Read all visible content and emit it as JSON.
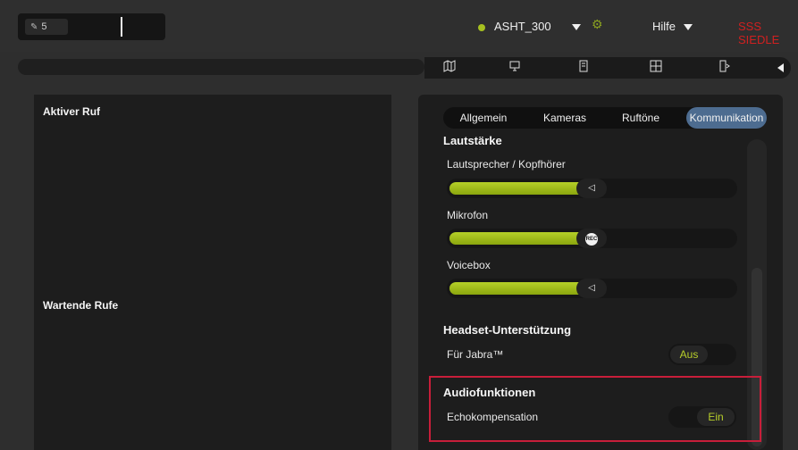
{
  "header": {
    "dialpad": {
      "icon": "pen-icon",
      "value": "5"
    },
    "device": {
      "name": "ASHT_300",
      "status_color": "#a6c020"
    },
    "settings_icon": "gear-icon",
    "help_label": "Hilfe",
    "brand": "SSS SIEDLE"
  },
  "toolbar": {
    "icons": [
      "book-icon",
      "monitor-icon",
      "panel-icon",
      "grid-icon",
      "door-icon",
      "collapse-left-icon"
    ]
  },
  "left": {
    "active_call_title": "Aktiver Ruf",
    "waiting_calls_title": "Wartende Rufe"
  },
  "tabs": [
    {
      "label": "Allgemein"
    },
    {
      "label": "Kameras"
    },
    {
      "label": "Ruftöne"
    },
    {
      "label": "Kommunikation",
      "active": true
    }
  ],
  "volume": {
    "heading": "Lautstärke",
    "speaker": {
      "label": "Lautsprecher / Kopfhörer",
      "level": 0.48,
      "icon": "speaker-icon"
    },
    "microphone": {
      "label": "Mikrofon",
      "level": 0.48,
      "icon": "rec-icon",
      "icon_text": "REC"
    },
    "voicebox": {
      "label": "Voicebox",
      "level": 0.48,
      "icon": "speaker-icon"
    }
  },
  "headset": {
    "heading": "Headset-Unterstützung",
    "jabra": {
      "label": "Für Jabra™",
      "value": "Aus"
    }
  },
  "audio": {
    "heading": "Audiofunktionen",
    "echo": {
      "label": "Echokompensation",
      "value": "Ein"
    }
  },
  "colors": {
    "accent_green": "#a6c020",
    "tab_active": "#4d6c90",
    "brand_red": "#d02020",
    "highlight_red": "#c81e3a"
  }
}
